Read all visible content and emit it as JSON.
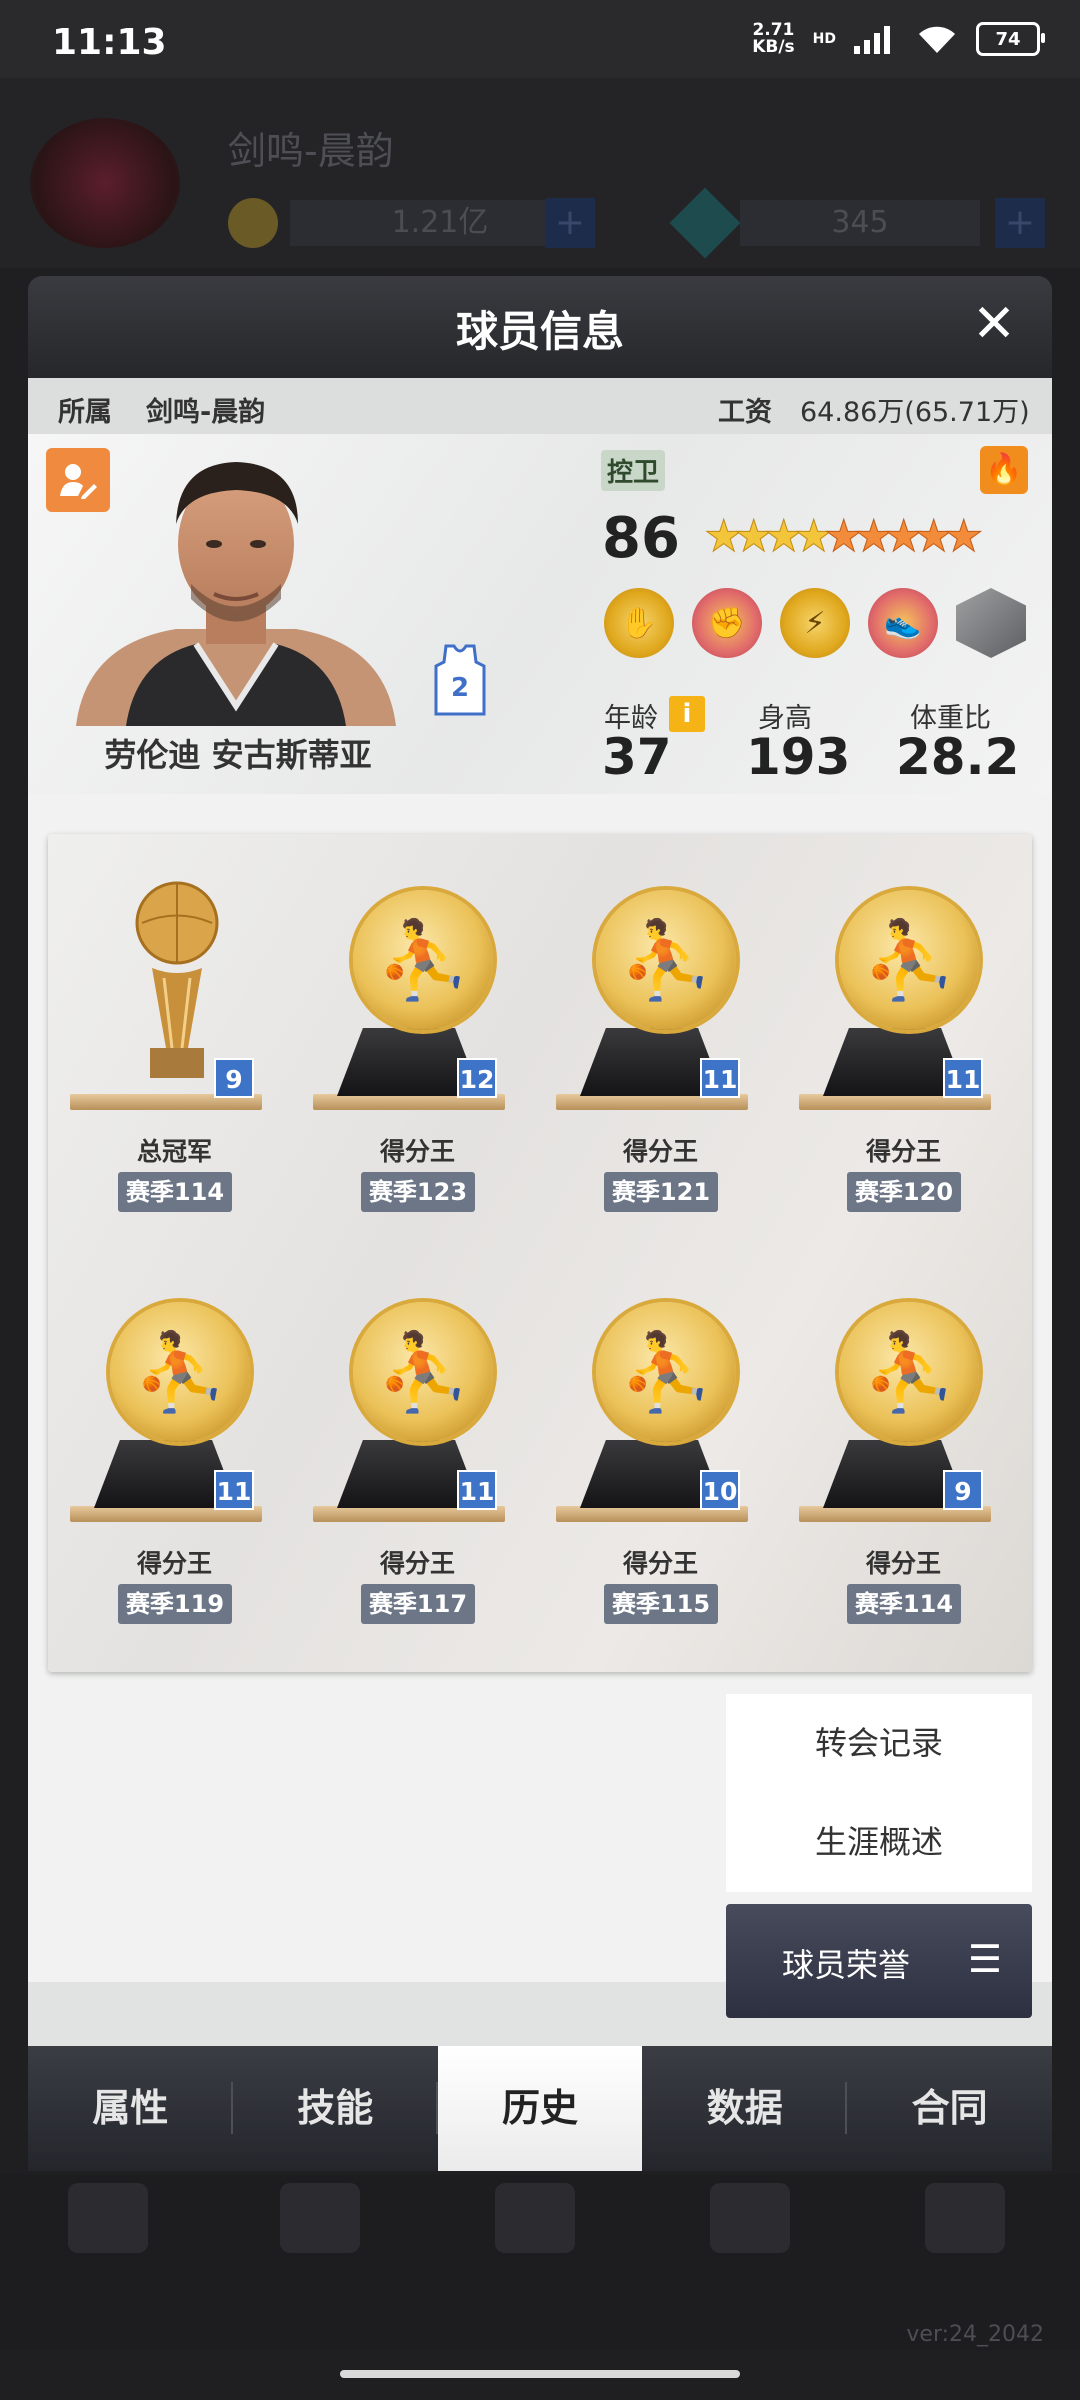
{
  "status": {
    "time": "11:13",
    "net_speed": "2.71",
    "net_unit": "KB/s",
    "net_type": "HD",
    "battery": "74"
  },
  "background": {
    "team_name": "剑鸣-晨韵",
    "coin_value": "1.21亿",
    "gem_value": "345",
    "version": "ver:24_2042"
  },
  "modal": {
    "title": "球员信息",
    "team_label": "所属",
    "team_value": "剑鸣-晨韵",
    "wage_label": "工资",
    "wage_value": "64.86万(65.71万)",
    "player": {
      "name": "劳伦迪 安古斯蒂亚",
      "jersey_number": "2",
      "position": "控卫",
      "rating": "86",
      "stars_gold": 4,
      "stars_orange": 5,
      "age_label": "年龄",
      "age": "37",
      "height_label": "身高",
      "height": "193",
      "weight_label": "体重比",
      "weight": "28.2"
    },
    "trophies": [
      {
        "award": "总冠军",
        "season": "赛季114",
        "count": "9",
        "kind": "cup"
      },
      {
        "award": "得分王",
        "season": "赛季123",
        "count": "12",
        "kind": "medal"
      },
      {
        "award": "得分王",
        "season": "赛季121",
        "count": "11",
        "kind": "medal"
      },
      {
        "award": "得分王",
        "season": "赛季120",
        "count": "11",
        "kind": "medal"
      },
      {
        "award": "得分王",
        "season": "赛季119",
        "count": "11",
        "kind": "medal"
      },
      {
        "award": "得分王",
        "season": "赛季117",
        "count": "11",
        "kind": "medal"
      },
      {
        "award": "得分王",
        "season": "赛季115",
        "count": "10",
        "kind": "medal"
      },
      {
        "award": "得分王",
        "season": "赛季114",
        "count": "9",
        "kind": "medal"
      }
    ],
    "menu": {
      "transfer": "转会记录",
      "career": "生涯概述",
      "honor": "球员荣誉"
    },
    "tabs": [
      "属性",
      "技能",
      "历史",
      "数据",
      "合同"
    ],
    "active_tab": "历史"
  },
  "colors": {
    "accent_orange": "#f08a3e",
    "count_blue": "#3e74c8",
    "season_tag": "#6c7686"
  }
}
